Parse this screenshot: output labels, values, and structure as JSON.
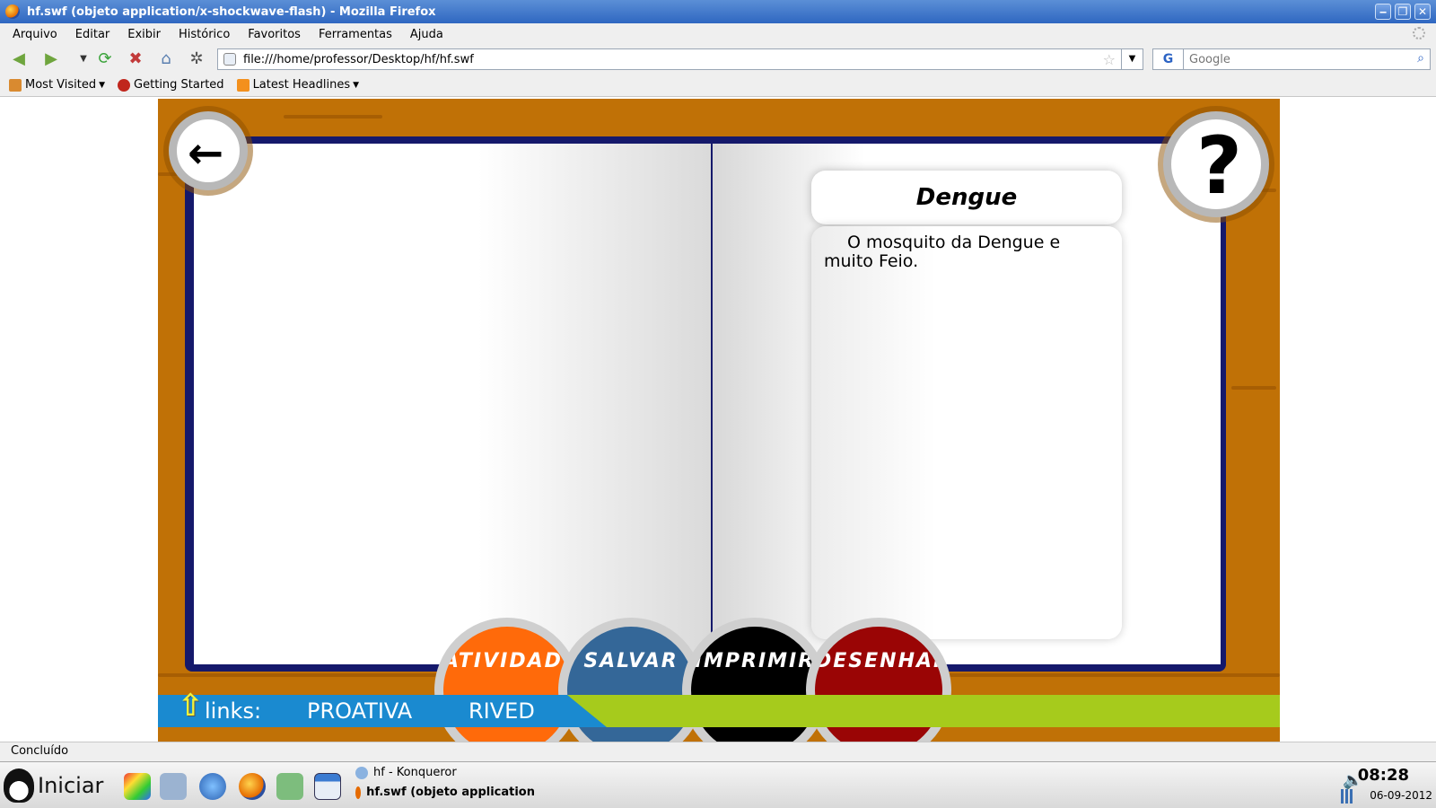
{
  "window": {
    "title": "hf.swf (objeto application/x-shockwave-flash) - Mozilla Firefox",
    "minimize": "‒",
    "maximize": "❐",
    "close": "✕"
  },
  "menu": [
    "Arquivo",
    "Editar",
    "Exibir",
    "Histórico",
    "Favoritos",
    "Ferramentas",
    "Ajuda"
  ],
  "nav": {
    "url": "file:///home/professor/Desktop/hf/hf.swf",
    "search_placeholder": "Google",
    "search_engine": "G"
  },
  "bookmarks": [
    {
      "label": "Most Visited",
      "dropdown": true,
      "color": "#d98a30"
    },
    {
      "label": "Getting Started",
      "dropdown": false,
      "color": "#c0261d"
    },
    {
      "label": "Latest Headlines",
      "dropdown": true,
      "color": "#f3901d"
    }
  ],
  "page": {
    "card_title": "Dengue",
    "card_text": "O mosquito da Dengue e muito Feio.",
    "back_icon": "←",
    "help_icon": "?",
    "buttons": {
      "atividades": "ATIVIDADES",
      "salvar": "SALVAR",
      "imprimir": "IMPRIMIR",
      "desenhar": "DESENHAR"
    },
    "links_label": "links:",
    "link1": "PROATIVA",
    "link2": "RIVED",
    "arrow_icon": "⇧"
  },
  "status": "Concluído",
  "taskbar": {
    "start": "Iniciar",
    "task1": "hf - Konqueror",
    "task2": "hf.swf (objeto application",
    "time": "08:28",
    "date": "06-09-2012"
  },
  "colors": {
    "wood": "#c07106",
    "book_cover": "#15196b",
    "atividades": "#ff6a0a",
    "salvar": "#346798",
    "imprimir": "#000000",
    "desenhar": "#9a0505",
    "links_blue": "#1a8ad0",
    "links_green": "#a6cb1c"
  }
}
